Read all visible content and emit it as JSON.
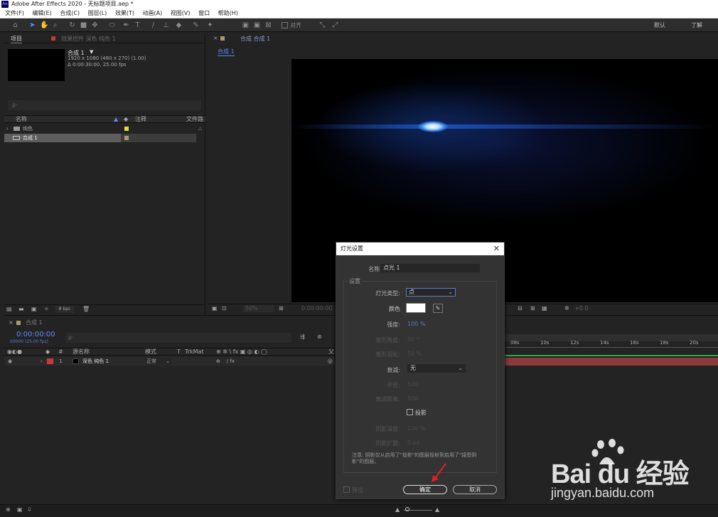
{
  "window": {
    "title": "Adobe After Effects 2020 - 无标题项目.aep *",
    "app_badge": "Ae"
  },
  "menu": [
    "文件(F)",
    "编辑(E)",
    "合成(C)",
    "图层(L)",
    "效果(T)",
    "动画(A)",
    "视图(V)",
    "窗口",
    "帮助(H)"
  ],
  "toolbar": {
    "align_label": "对齐",
    "workspace_default": "默认",
    "workspace_learn": "了解"
  },
  "project": {
    "tab_project": "项目",
    "tab_effects": "效果控件 深色 纯色 1",
    "comp_name": "合成 1",
    "comp_info1": "1920 x 1080 (480 x 270) (1.00)",
    "comp_info2": "Δ 0:00:30:00, 25.00 fps",
    "search_placeholder": "ρ·",
    "col_name": "名称",
    "col_comment": "注释",
    "col_file": "文件路",
    "items": [
      {
        "name": "纯色",
        "type": "folder",
        "color": "#e8e030"
      },
      {
        "name": "合成 1",
        "type": "comp",
        "color": "#a89a70"
      }
    ],
    "bpc": "8 bpc"
  },
  "viewer": {
    "tab": "合成 合成 1",
    "comp_tab": "合成 1",
    "zoom": "50%",
    "timecode": "0:00:00:00",
    "exposure": "+0.0"
  },
  "timeline": {
    "tab": "合成 1",
    "timecode": "0:00:00:00",
    "fps_line": "00000 (25.00 fps)",
    "col_source": "源名称",
    "col_mode": "模式",
    "col_t": "T",
    "col_trkmat": "TrkMat",
    "col_parent": "父",
    "layer": {
      "index": "1",
      "name": "深色 纯色 1",
      "mode": "正常",
      "color": "#c83a3a"
    },
    "ruler": [
      "08s",
      "10s",
      "12s",
      "14s",
      "16s",
      "18s",
      "20s"
    ]
  },
  "dialog": {
    "title": "灯光设置",
    "name_label": "名称:",
    "name_value": "点光 1",
    "group_label": "设置",
    "type_label": "灯光类型:",
    "type_value": "点",
    "color_label": "颜色",
    "intensity_label": "强度:",
    "intensity_value": "100 %",
    "cone_angle_label": "锥形角度:",
    "cone_angle_value": "90 °",
    "cone_feather_label": "锥形羽化:",
    "cone_feather_value": "50 %",
    "falloff_label": "衰减:",
    "falloff_value": "无",
    "radius_label": "半径:",
    "radius_value": "500",
    "falloff_dist_label": "衰减距离:",
    "falloff_dist_value": "500",
    "shadow_label": "投影",
    "shadow_dark_label": "阴影深度:",
    "shadow_dark_value": "100 %",
    "shadow_diff_label": "阴影扩散:",
    "shadow_diff_value": "0 px",
    "note": "注意: 阴影仅从启用了\"投影\"的图层投射到启用了\"接受阴影\"的图层。",
    "preview_label": "预览",
    "ok_label": "确定",
    "cancel_label": "取消",
    "swatch_color": "#ffffff"
  },
  "watermark": {
    "brand": "Bai du 经验",
    "url": "jingyan.baidu.com"
  }
}
